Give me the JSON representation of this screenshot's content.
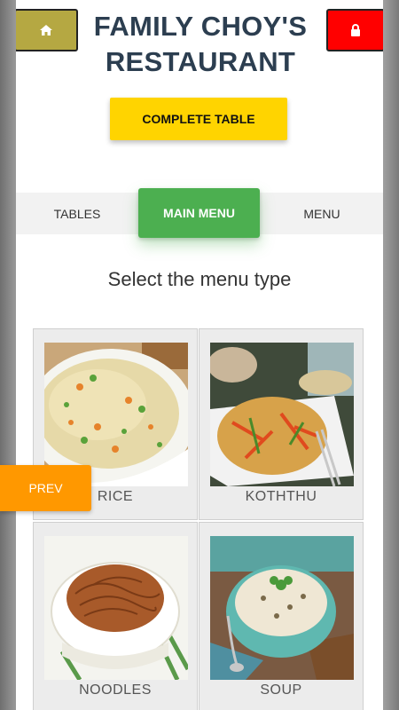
{
  "header": {
    "title_line1": "FAMILY CHOY'S",
    "title_line2": "RESTAURANT",
    "home_icon": "home-icon",
    "lock_icon": "lock-icon"
  },
  "actions": {
    "complete_table_label": "COMPLETE TABLE",
    "prev_label": "PREV"
  },
  "tabs": [
    {
      "label": "TABLES"
    },
    {
      "label": "MAIN MENU",
      "active": true
    },
    {
      "label": "MENU"
    }
  ],
  "section": {
    "subtitle": "Select the menu type"
  },
  "menu_types": [
    {
      "label": "RICE"
    },
    {
      "label": "KOTHTHU"
    },
    {
      "label": "NOODLES"
    },
    {
      "label": "SOUP"
    }
  ],
  "colors": {
    "home_button": "#b5a842",
    "lock_button": "#ff0000",
    "complete_button": "#ffd400",
    "active_tab": "#4caf50",
    "prev_button": "#ff9800",
    "title": "#2c3e50"
  }
}
